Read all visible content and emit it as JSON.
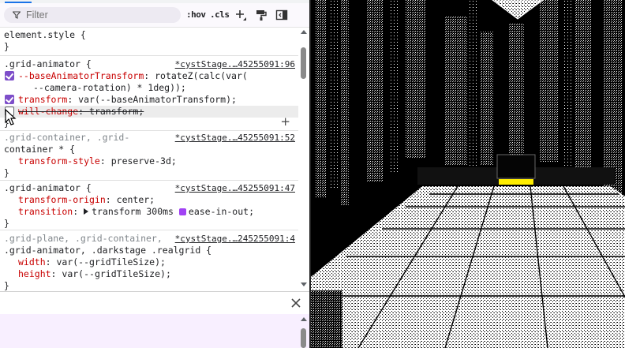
{
  "toolbar": {
    "filter_placeholder": "Filter",
    "hov_label": ":hov",
    "cls_label": ".cls"
  },
  "rules": {
    "element_style": {
      "selector": "element.style {",
      "close": "}"
    },
    "r1": {
      "selector": ".grid-animator {",
      "source": "*cystStage.…45255091:96",
      "d1_prop": "--baseAnimatorTransform",
      "d1_val": "rotateZ(calc(var(",
      "d1_val_cont": "--camera-rotation) * 1deg));",
      "d2_prop": "transform",
      "d2_val": "var(--baseAnimatorTransform);",
      "d3_prop": "will-change",
      "d3_val": "transform;",
      "close": "}"
    },
    "r2": {
      "selector_a": ".grid-container, .grid-",
      "selector_b": "container * {",
      "source": "*cystStage.…45255091:52",
      "d1_prop": "transform-style",
      "d1_val": "preserve-3d;",
      "close": "}"
    },
    "r3": {
      "selector": ".grid-animator {",
      "source": "*cystStage.…45255091:47",
      "d1_prop": "transform-origin",
      "d1_val": "center;",
      "d2_prop": "transition",
      "d2_val_a": "transform 300ms",
      "d2_val_b": "ease-in-out;",
      "close": "}"
    },
    "r4": {
      "selector_a": ".grid-plane, .grid-container,",
      "selector_b": ".grid-animator, .darkstage .realgrid {",
      "source": "*cystStage.…245255091:4",
      "d1_prop": "width",
      "d1_val": "var(--gridTileSize);",
      "d2_prop": "height",
      "d2_val": "var(--gridTileSize);",
      "close": "}"
    }
  },
  "icons": {
    "filter": "filter-icon",
    "new_rule": "plus-icon",
    "paint": "paint-roller-icon",
    "sidebar": "toggle-sidebar-icon",
    "close": "close-icon"
  },
  "colors": {
    "accent": "#7d4ec9",
    "property": "#c80000",
    "drawer_bg": "#f8efff",
    "swatch": "#a142f4"
  }
}
